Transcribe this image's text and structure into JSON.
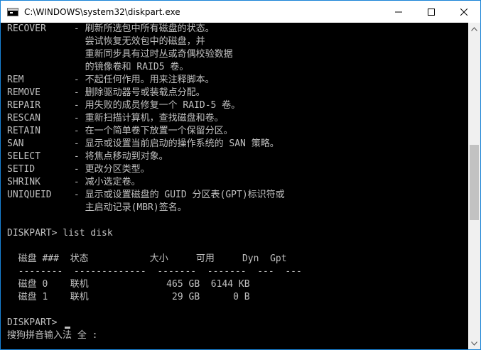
{
  "window": {
    "title": "C:\\WINDOWS\\system32\\diskpart.exe",
    "controls": {
      "minimize": "minimize-icon",
      "maximize": "maximize-icon",
      "close": "close-icon"
    }
  },
  "console": {
    "lines": [
      "RECOVER     - 刷新所选包中所有磁盘的状态。",
      "              尝试恢复无效包中的磁盘，并",
      "              重新同步具有过时丛或奇偶校验数据",
      "              的镜像卷和 RAID5 卷。",
      "REM         - 不起任何作用。用来注释脚本。",
      "REMOVE      - 删除驱动器号或装载点分配。",
      "REPAIR      - 用失败的成员修复一个 RAID-5 卷。",
      "RESCAN      - 重新扫描计算机，查找磁盘和卷。",
      "RETAIN      - 在一个简单卷下放置一个保留分区。",
      "SAN         - 显示或设置当前启动的操作系统的 SAN 策略。",
      "SELECT      - 将焦点移动到对象。",
      "SETID       - 更改分区类型。",
      "SHRINK      - 减小选定卷。",
      "UNIQUEID    - 显示或设置磁盘的 GUID 分区表(GPT)标识符或",
      "              主启动记录(MBR)签名。",
      "",
      "DISKPART> list disk",
      "",
      "  磁盘 ###  状态           大小     可用     Dyn  Gpt",
      "  --------  -------------  -------  -------  ---  ---",
      "  磁盘 0    联机              465 GB  6144 KB",
      "  磁盘 1    联机               29 GB      0 B",
      "",
      "DISKPART> ",
      "搜狗拼音输入法 全 :"
    ]
  },
  "scrollbar": {
    "position": 0.42
  }
}
